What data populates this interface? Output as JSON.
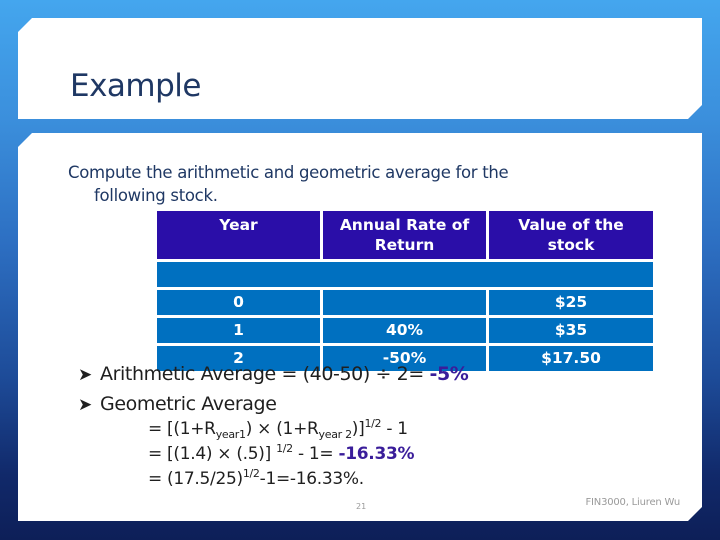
{
  "slide": {
    "title": "Example",
    "intro_line1": "Compute the arithmetic and geometric average for the",
    "intro_line2": "following stock.",
    "table": {
      "headers": [
        "Year",
        "Annual Rate of Return",
        "Value of the stock"
      ],
      "header_lines": [
        [
          "Year"
        ],
        [
          "Annual Rate of",
          "Return"
        ],
        [
          "Value of the",
          "stock"
        ]
      ],
      "rows": [
        [
          "0",
          "",
          "$25"
        ],
        [
          "1",
          "40%",
          "$35"
        ],
        [
          "2",
          "-50%",
          "$17.50"
        ]
      ]
    },
    "bullets": [
      {
        "icon": "arrow-bullet-icon",
        "text": "Arithmetic Average = (40-50) ÷ 2= ",
        "highlight": "-5%"
      },
      {
        "icon": "arrow-bullet-icon",
        "text": "Geometric Average",
        "highlight": ""
      }
    ],
    "formulas": {
      "line1": {
        "p1": "= [(1+R",
        "sub1": "year1",
        "p2": ") × (1+R",
        "sub2": "year 2",
        "p3": ")]",
        "sup": "1/2",
        "p4": " - 1"
      },
      "line2": {
        "p1": "= [(1.4) × (.5)] ",
        "sup": "1/2",
        "p2": " - 1= ",
        "highlight": "-16.33%"
      },
      "line3": {
        "p1": "= (17.5/25)",
        "sup": "1/2",
        "p2": "-1=-16.33%."
      }
    },
    "page_number": "21",
    "footer": "FIN3000, Liuren Wu"
  },
  "colors": {
    "title_text": "#1f3864",
    "table_header": "#2a0ea8",
    "table_row": "#0070c0",
    "highlight": "#3a1d9a"
  }
}
